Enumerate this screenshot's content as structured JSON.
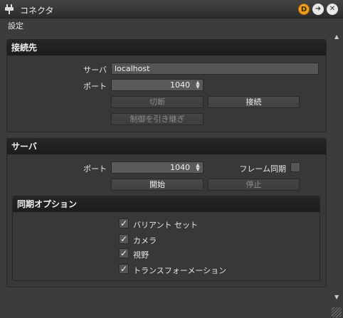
{
  "window": {
    "title": "コネクタ",
    "btn_d_label": "D",
    "btn_arrow_label": "➜",
    "btn_close_label": "✕",
    "accent": "#f0a020"
  },
  "menu": {
    "settings": "設定"
  },
  "connect_panel": {
    "header": "接続先",
    "server_label": "サーバ",
    "server_value": "localhost",
    "port_label": "ポート",
    "port_value": "1040",
    "disconnect_label": "切断",
    "connect_label": "接続",
    "takeover_label": "制御を引き継ぎ"
  },
  "server_panel": {
    "header": "サーバ",
    "port_label": "ポート",
    "port_value": "1040",
    "frame_sync_label": "フレーム同期",
    "frame_sync_checked": false,
    "start_label": "開始",
    "stop_label": "停止"
  },
  "sync_options": {
    "header": "同期オプション",
    "items": [
      {
        "label": "バリアント セット",
        "checked": true
      },
      {
        "label": "カメラ",
        "checked": true
      },
      {
        "label": "視野",
        "checked": true
      },
      {
        "label": "トランスフォーメーション",
        "checked": true
      }
    ]
  },
  "icons": {
    "plug": "plug-icon",
    "check": "✓",
    "spin_up": "▲",
    "spin_down": "▼",
    "scroll_up": "▲",
    "scroll_down": "▼"
  }
}
